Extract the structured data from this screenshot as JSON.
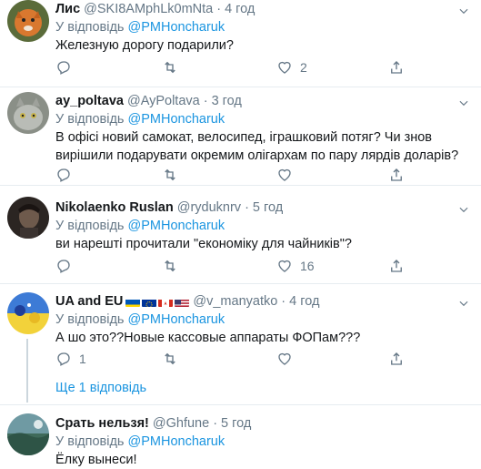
{
  "reply_prefix": "У відповідь",
  "tweets": [
    {
      "name": "Лис",
      "handle": "@SKI8AMphLk0mNta",
      "time": "4 год",
      "reply_to": "@PMHoncharuk",
      "text": "Железную дорогу подарили?",
      "likes": "2",
      "retweets": "",
      "replies": ""
    },
    {
      "name": "ay_poltava",
      "handle": "@AyPoltava",
      "time": "3 год",
      "reply_to": "@PMHoncharuk",
      "text": "В офісі новий самокат, велосипед, іграшковий потяг? Чи знов вирішили подарувати окремим олігархам по пару лярдів доларів?",
      "likes": "",
      "retweets": "",
      "replies": ""
    },
    {
      "name": "Nikolaenko Ruslan",
      "handle": "@ryduknrv",
      "time": "5 год",
      "reply_to": "@PMHoncharuk",
      "text": "ви нарешті прочитали \"економіку для чайників\"?",
      "likes": "16",
      "retweets": "",
      "replies": ""
    },
    {
      "name": "UA and EU",
      "handle": "@v_manyatko",
      "time": "4 год",
      "reply_to": "@PMHoncharuk",
      "text": "А шо это??Новые кассовые аппараты ФОПам???",
      "likes": "",
      "retweets": "",
      "replies": "1",
      "show_replies": "Ще 1 відповідь"
    },
    {
      "name": "Срать нельзя!",
      "handle": "@Ghfune",
      "time": "5 год",
      "reply_to": "@PMHoncharuk",
      "text": "Ёлку вынеси!",
      "likes": "",
      "retweets": "",
      "replies": ""
    }
  ],
  "colors": {
    "link": "#1b95e0",
    "secondary": "#657786",
    "border": "#e6ecf0"
  },
  "icons": [
    "reply-icon",
    "retweet-icon",
    "like-icon",
    "share-icon",
    "caret-down-icon"
  ]
}
